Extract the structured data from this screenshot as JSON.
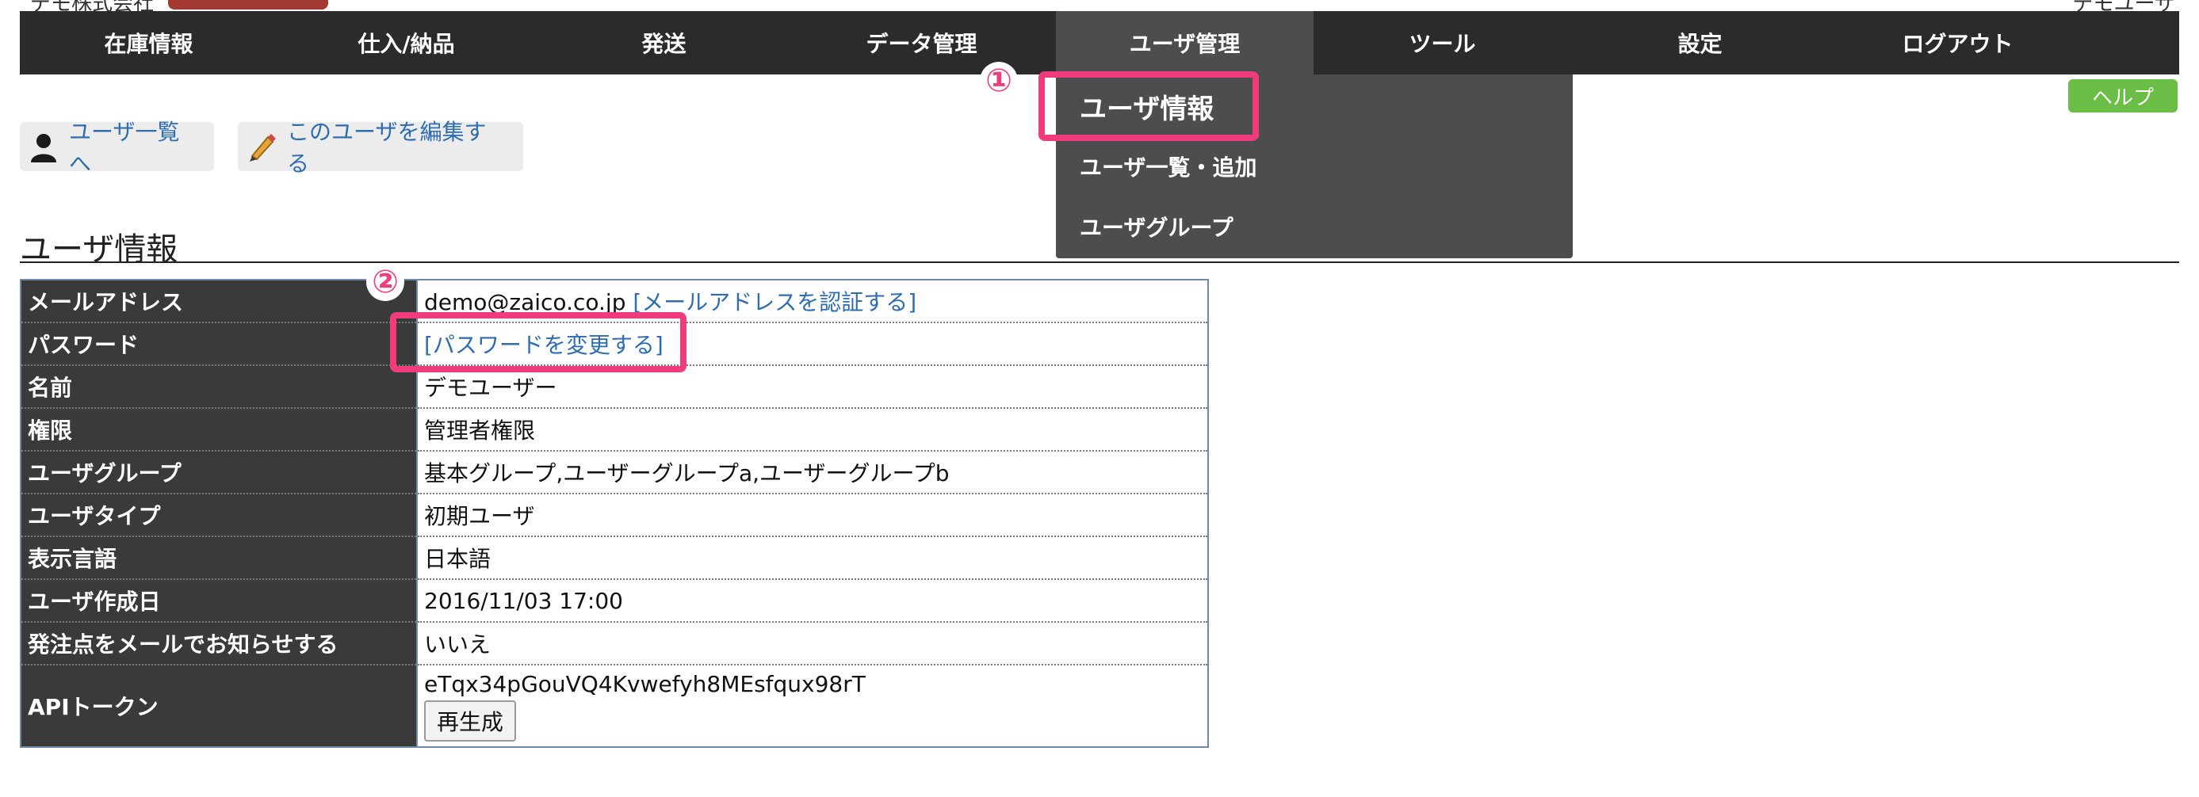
{
  "header": {
    "company": "デモ株式会社",
    "user": "デモユーザ"
  },
  "nav": {
    "items": [
      {
        "label": "在庫情報"
      },
      {
        "label": "仕入/納品"
      },
      {
        "label": "発送"
      },
      {
        "label": "データ管理"
      },
      {
        "label": "ユーザ管理"
      },
      {
        "label": "ツール"
      },
      {
        "label": "設定"
      },
      {
        "label": "ログアウト"
      }
    ],
    "active_index": 4,
    "dropdown": [
      {
        "label": "ユーザ情報"
      },
      {
        "label": "ユーザ一覧・追加"
      },
      {
        "label": "ユーザグループ"
      }
    ]
  },
  "annotations": {
    "num1": "①",
    "num2": "②",
    "color": "#f03c7c"
  },
  "help_label": "ヘルプ",
  "actions": {
    "user_list": "ユーザ一覧へ",
    "edit_user": "このユーザを編集する"
  },
  "section_title": "ユーザ情報",
  "info": {
    "email": {
      "label": "メールアドレス",
      "value": "demo@zaico.co.jp",
      "link": "[メールアドレスを認証する]"
    },
    "password": {
      "label": "パスワード",
      "link": "[パスワードを変更する]"
    },
    "name": {
      "label": "名前",
      "value": "デモユーザー"
    },
    "permission": {
      "label": "権限",
      "value": "管理者権限"
    },
    "group": {
      "label": "ユーザグループ",
      "value": "基本グループ,ユーザーグループa,ユーザーグループb"
    },
    "type": {
      "label": "ユーザタイプ",
      "value": "初期ユーザ"
    },
    "language": {
      "label": "表示言語",
      "value": "日本語"
    },
    "created": {
      "label": "ユーザ作成日",
      "value": "2016/11/03 17:00"
    },
    "notify": {
      "label": "発注点をメールでお知らせする",
      "value": "いいえ"
    },
    "api": {
      "label": "APIトークン",
      "value": "eTqx34pGouVQ4Kvwefyh8MEsfqux98rT",
      "button": "再生成"
    }
  },
  "colors": {
    "nav_bg": "#2b2b2b",
    "nav_active": "#4d4d4d",
    "link": "#2f6db0",
    "help": "#6abe45",
    "badge": "#a23a32"
  },
  "icons": [
    "user-icon",
    "pencil-icon"
  ]
}
